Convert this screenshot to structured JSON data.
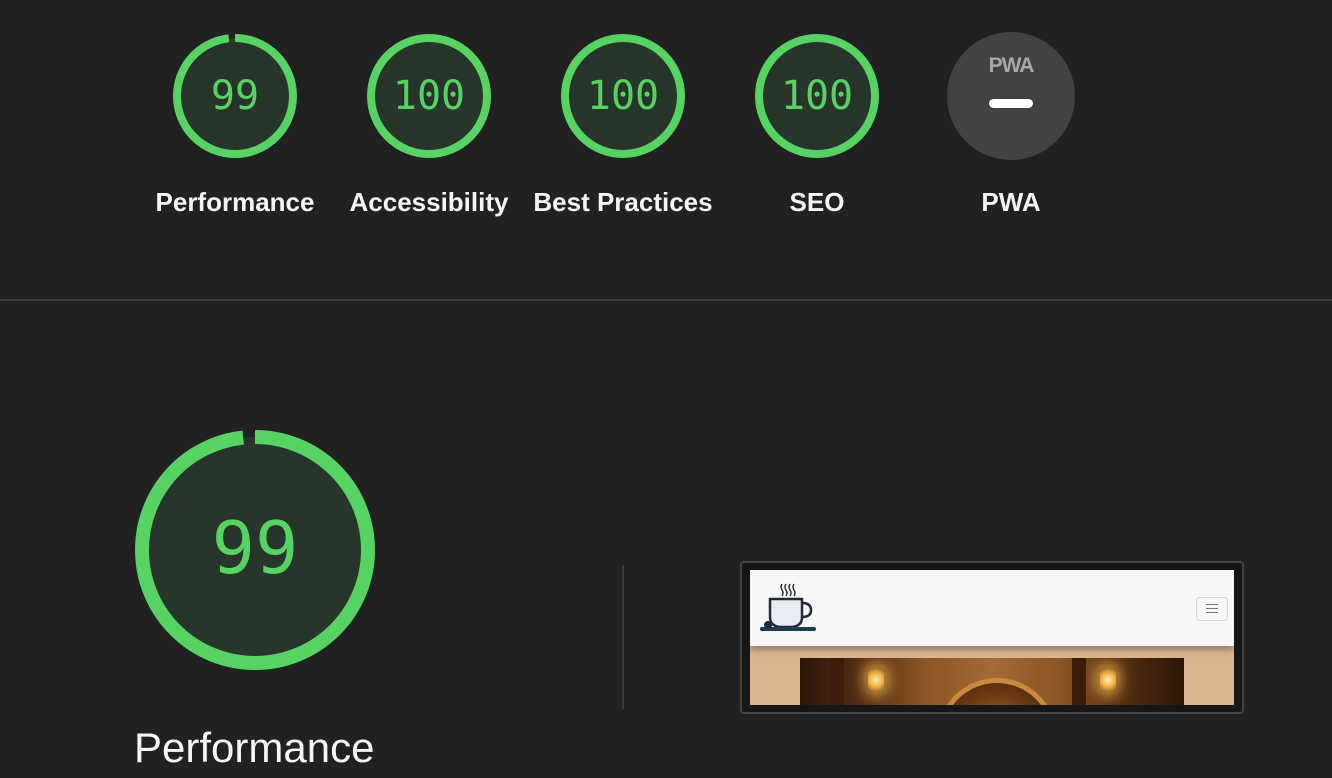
{
  "colors": {
    "background": "#212121",
    "pass": "#57d364",
    "pass_fill": "#27352a",
    "pwa_circle": "#424242",
    "text": "#f5f5f5"
  },
  "categories": [
    {
      "score": "99",
      "label": "Performance",
      "fraction": 0.99
    },
    {
      "score": "100",
      "label": "Accessibility",
      "fraction": 1.0
    },
    {
      "score": "100",
      "label": "Best Practices",
      "fraction": 1.0
    },
    {
      "score": "100",
      "label": "SEO",
      "fraction": 1.0
    }
  ],
  "pwa": {
    "logo_text": "PWA",
    "label": "PWA",
    "icon": "minus-dash-icon"
  },
  "performance_detail": {
    "score": "99",
    "fraction": 0.99,
    "label": "Performance"
  },
  "thumbnail": {
    "logo_icon": "coffee-cup-icon",
    "menu_icon": "hamburger-menu-icon"
  }
}
